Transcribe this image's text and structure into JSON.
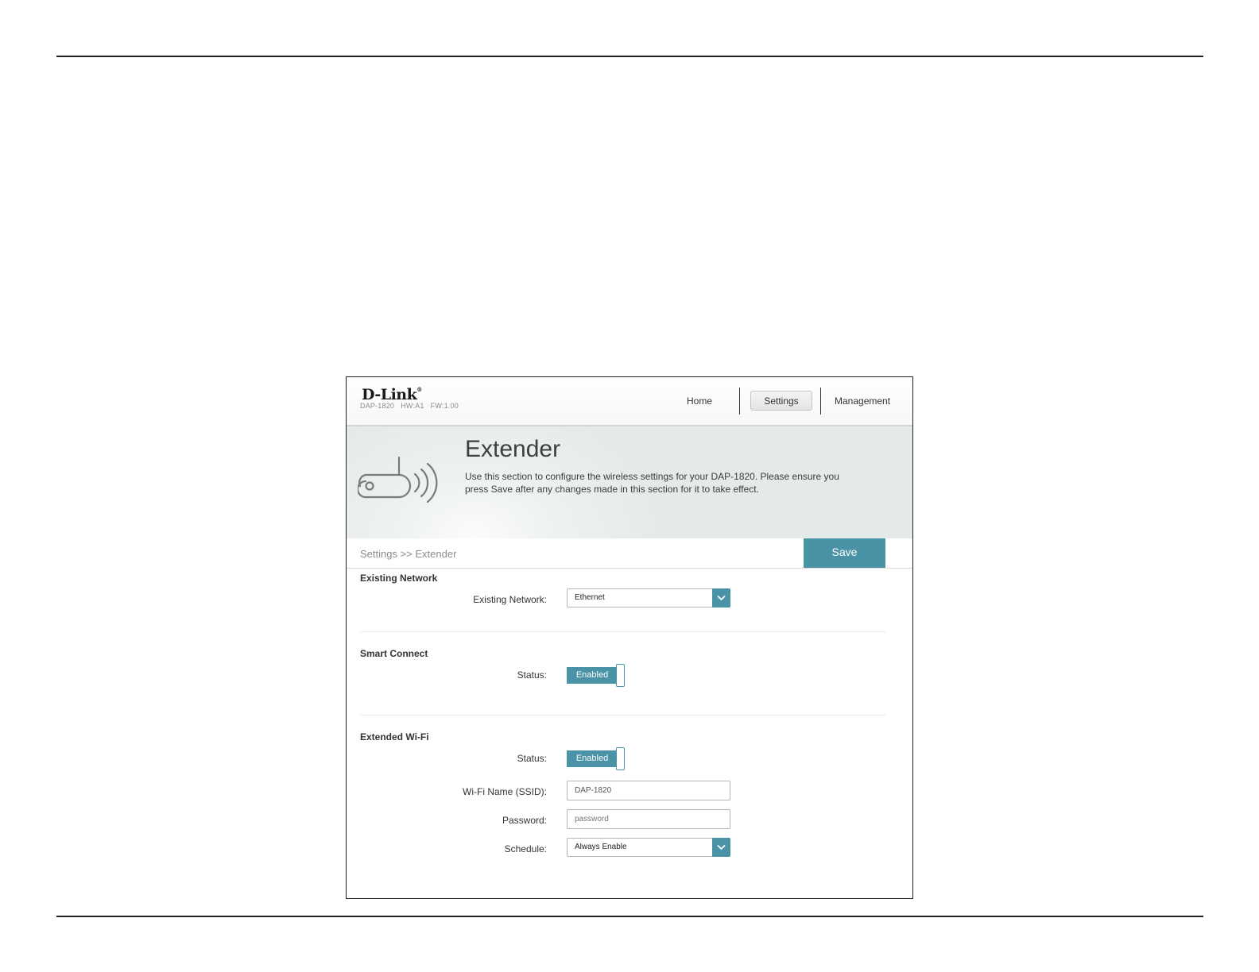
{
  "header": {
    "brand": "D-Link",
    "brand_mark": "®",
    "device_info": "DAP-1820   HW:A1   FW:1.00",
    "nav": {
      "home": "Home",
      "settings": "Settings",
      "management": "Management"
    }
  },
  "banner": {
    "icon": "router-wifi-icon",
    "title": "Extender",
    "description": "Use this section to configure the wireless settings for your DAP-1820. Please ensure you press Save after any changes made in this section for it to take effect."
  },
  "toolbar": {
    "breadcrumb": "Settings >> Extender",
    "save_label": "Save"
  },
  "existing_network": {
    "title": "Existing Network",
    "label": "Existing Network:",
    "value": "Ethernet"
  },
  "smart_connect": {
    "title": "Smart Connect",
    "status_label": "Status:",
    "status_value": "Enabled"
  },
  "extended_wifi": {
    "title": "Extended Wi-Fi",
    "status_label": "Status:",
    "status_value": "Enabled",
    "ssid_label": "Wi-Fi Name (SSID):",
    "ssid_value": "DAP-1820",
    "password_label": "Password:",
    "password_placeholder": "password",
    "schedule_label": "Schedule:",
    "schedule_value": "Always Enable"
  },
  "colors": {
    "accent": "#4a93a6",
    "text": "#333333",
    "muted": "#8c8c8c"
  }
}
